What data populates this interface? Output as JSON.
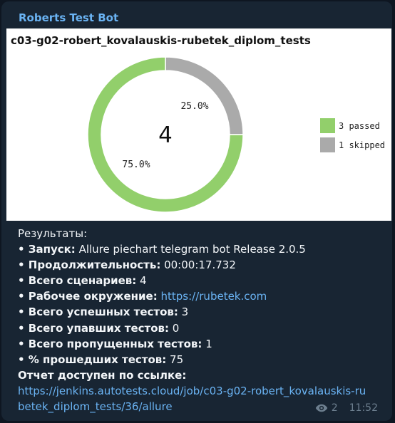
{
  "message": {
    "sender": "Roberts Test Bot",
    "views": "2",
    "time": "11:52"
  },
  "chart": {
    "title": "c03-g02-robert_kovalauskis-rubetek_diplom_tests"
  },
  "chart_data": {
    "type": "pie",
    "center_label": "4",
    "slices": [
      {
        "label": "3 passed",
        "value": 3,
        "percent_label": "75.0%",
        "color": "#92cf6b"
      },
      {
        "label": "1 skipped",
        "value": 1,
        "percent_label": "25.0%",
        "color": "#aaaaaa"
      }
    ]
  },
  "results": {
    "heading": "Результаты:",
    "lines": [
      {
        "label": "• Запуск:",
        "value": " Allure piechart telegram bot Release 2.0.5"
      },
      {
        "label": "• Продолжительность:",
        "value": " 00:00:17.732"
      },
      {
        "label": "• Всего сценариев:",
        "value": " 4"
      },
      {
        "label": "• Рабочее окружение:",
        "value": " ",
        "link": "https://rubetek.com"
      },
      {
        "label": "• Всего успешных тестов:",
        "value": " 3"
      },
      {
        "label": "• Всего упавших тестов:",
        "value": " 0"
      },
      {
        "label": "• Всего пропущенных тестов:",
        "value": " 1"
      },
      {
        "label": "• % прошедших тестов:",
        "value": " 75"
      }
    ],
    "report_label": "Отчет доступен по ссылке:",
    "report_url": "https://jenkins.autotests.cloud/job/c03-g02-robert_kovalauskis-rubetek_diplom_tests/36/allure"
  }
}
